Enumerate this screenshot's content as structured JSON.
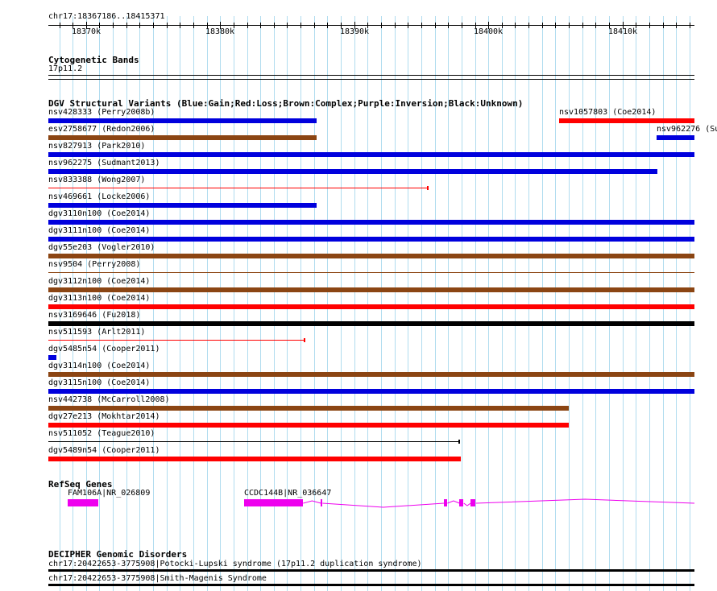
{
  "browser": {
    "location": "chr17:18367186..18415371",
    "start": 18367186,
    "end": 18415371,
    "ticks": [
      {
        "pos": 18370000,
        "label": "18370k"
      },
      {
        "pos": 18380000,
        "label": "18380k"
      },
      {
        "pos": 18390000,
        "label": "18390k"
      },
      {
        "pos": 18400000,
        "label": "18400k"
      },
      {
        "pos": 18410000,
        "label": "18410k"
      }
    ]
  },
  "tracks": {
    "cyto": {
      "title": "Cytogenetic Bands",
      "band": "17p11.2"
    },
    "dgv": {
      "title": "DGV Structural Variants (Blue:Gain;Red:Loss;Brown:Complex;Purple:Inversion;Black:Unknown)",
      "colors": {
        "gain": "#0000dd",
        "loss": "#ff0000",
        "complex": "#8b4513",
        "unknown": "#000000"
      },
      "rows": [
        {
          "features": [
            {
              "label": "nsv428333 (Perry2008b)",
              "type": "gain",
              "style": "bar",
              "start": 18367186,
              "end": 18387180
            },
            {
              "label": "nsv1057803 (Coe2014)",
              "type": "loss",
              "style": "bar",
              "start": 18405300,
              "end": 18415371
            }
          ]
        },
        {
          "features": [
            {
              "label": "esv2758677 (Redon2006)",
              "type": "complex",
              "style": "bar",
              "start": 18367186,
              "end": 18387180
            },
            {
              "label": "nsv962276 (Su",
              "type": "gain",
              "style": "bar",
              "start": 18412550,
              "end": 18415371
            }
          ]
        },
        {
          "features": [
            {
              "label": "nsv827913 (Park2010)",
              "type": "gain",
              "style": "bar",
              "start": 18367186,
              "end": 18415371
            }
          ]
        },
        {
          "features": [
            {
              "label": "nsv962275 (Sudmant2013)",
              "type": "gain",
              "style": "bar",
              "start": 18367186,
              "end": 18412620
            }
          ]
        },
        {
          "features": [
            {
              "label": "nsv833388 (Wong2007)",
              "type": "loss",
              "style": "line",
              "start": 18367186,
              "end": 18395500
            }
          ]
        },
        {
          "features": [
            {
              "label": "nsv469661 (Locke2006)",
              "type": "gain",
              "style": "bar",
              "start": 18367186,
              "end": 18387180
            }
          ]
        },
        {
          "features": [
            {
              "label": "dgv3110n100 (Coe2014)",
              "type": "gain",
              "style": "bar",
              "start": 18367186,
              "end": 18415371
            }
          ]
        },
        {
          "features": [
            {
              "label": "dgv3111n100 (Coe2014)",
              "type": "gain",
              "style": "bar",
              "start": 18367186,
              "end": 18415371
            }
          ]
        },
        {
          "features": [
            {
              "label": "dgv55e203 (Vogler2010)",
              "type": "complex",
              "style": "bar",
              "start": 18367186,
              "end": 18415371
            }
          ]
        },
        {
          "features": [
            {
              "label": "nsv9504 (Perry2008)",
              "type": "complex",
              "style": "line",
              "start": 18367186,
              "end": 18415371
            }
          ]
        },
        {
          "features": [
            {
              "label": "dgv3112n100 (Coe2014)",
              "type": "complex",
              "style": "bar",
              "start": 18367186,
              "end": 18415371
            }
          ]
        },
        {
          "features": [
            {
              "label": "dgv3113n100 (Coe2014)",
              "type": "loss",
              "style": "bar",
              "start": 18367186,
              "end": 18415371
            }
          ]
        },
        {
          "features": [
            {
              "label": "nsv3169646 (Fu2018)",
              "type": "unknown",
              "style": "bar",
              "start": 18367186,
              "end": 18415371
            }
          ]
        },
        {
          "features": [
            {
              "label": "nsv511593 (Arlt2011)",
              "type": "loss",
              "style": "line",
              "start": 18367186,
              "end": 18386280
            }
          ]
        },
        {
          "features": [
            {
              "label": "dgv5485n54 (Cooper2011)",
              "type": "gain",
              "style": "bar",
              "start": 18367186,
              "end": 18367790
            }
          ]
        },
        {
          "features": [
            {
              "label": "dgv3114n100 (Coe2014)",
              "type": "complex",
              "style": "bar",
              "start": 18367186,
              "end": 18415371
            }
          ]
        },
        {
          "features": [
            {
              "label": "dgv3115n100 (Coe2014)",
              "type": "gain",
              "style": "bar",
              "start": 18367186,
              "end": 18415371
            }
          ]
        },
        {
          "features": [
            {
              "label": "nsv442738 (McCarroll2008)",
              "type": "complex",
              "style": "bar",
              "start": 18367186,
              "end": 18405980
            }
          ]
        },
        {
          "features": [
            {
              "label": "dgv27e213 (Mokhtar2014)",
              "type": "loss",
              "style": "bar",
              "start": 18367186,
              "end": 18405980
            }
          ]
        },
        {
          "features": [
            {
              "label": "nsv511052 (Teague2010)",
              "type": "unknown",
              "style": "line",
              "start": 18367186,
              "end": 18397850
            }
          ]
        },
        {
          "features": [
            {
              "label": "dgv5489n54 (Cooper2011)",
              "type": "loss",
              "style": "bar",
              "start": 18367186,
              "end": 18397970
            }
          ]
        }
      ]
    },
    "refseq": {
      "title": "RefSeq Genes",
      "color": "#ee00ee",
      "genes": [
        {
          "label": "FAM106A|NR_026809",
          "start": 18368630,
          "end": 18370920,
          "exons": [
            [
              18368630,
              18370920
            ]
          ]
        },
        {
          "label": "CCDC144B|NR_036647",
          "start": 18381790,
          "end": 18415371,
          "exons": [
            [
              18381790,
              18386190
            ],
            [
              18387520,
              18387640
            ],
            [
              18396700,
              18396950
            ],
            [
              18397850,
              18398170
            ],
            [
              18398680,
              18399070
            ]
          ]
        }
      ]
    },
    "decipher": {
      "title": "DECIPHER Genomic Disorders",
      "color": "#000000",
      "features": [
        {
          "label": "chr17:20422653-3775908|Potocki-Lupski syndrome (17p11.2 duplication syndrome)",
          "start": 18367186,
          "end": 18415371
        },
        {
          "label": "chr17:20422653-3775908|Smith-Magenis Syndrome",
          "start": 18367186,
          "end": 18415371
        }
      ]
    }
  }
}
